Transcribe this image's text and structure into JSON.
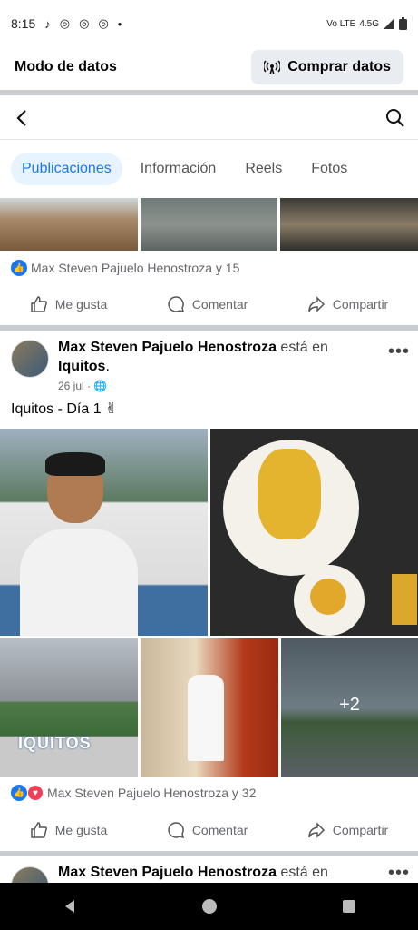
{
  "statusbar": {
    "time": "8:15",
    "network": "4.5G",
    "carrier": "Vo LTE"
  },
  "data_mode": {
    "title": "Modo de datos",
    "buy_label": "Comprar datos"
  },
  "tabs": [
    "Publicaciones",
    "Información",
    "Reels",
    "Fotos"
  ],
  "post1": {
    "reactions_text": "Max Steven Pajuelo Henostroza y 15",
    "actions": {
      "like": "Me gusta",
      "comment": "Comentar",
      "share": "Compartir"
    }
  },
  "post2": {
    "author": "Max Steven Pajuelo Henostroza",
    "at_text": "está en",
    "place": "Iquitos",
    "date": "26 jul",
    "caption": "Iquitos - Día 1 ✌",
    "photo_sign": "IQUITOS",
    "more_photos": "+2",
    "reactions_text": "Max Steven Pajuelo Henostroza y 32",
    "actions": {
      "like": "Me gusta",
      "comment": "Comentar",
      "share": "Compartir"
    }
  },
  "post3": {
    "author": "Max Steven Pajuelo Henostroza",
    "at_text": "está en"
  }
}
